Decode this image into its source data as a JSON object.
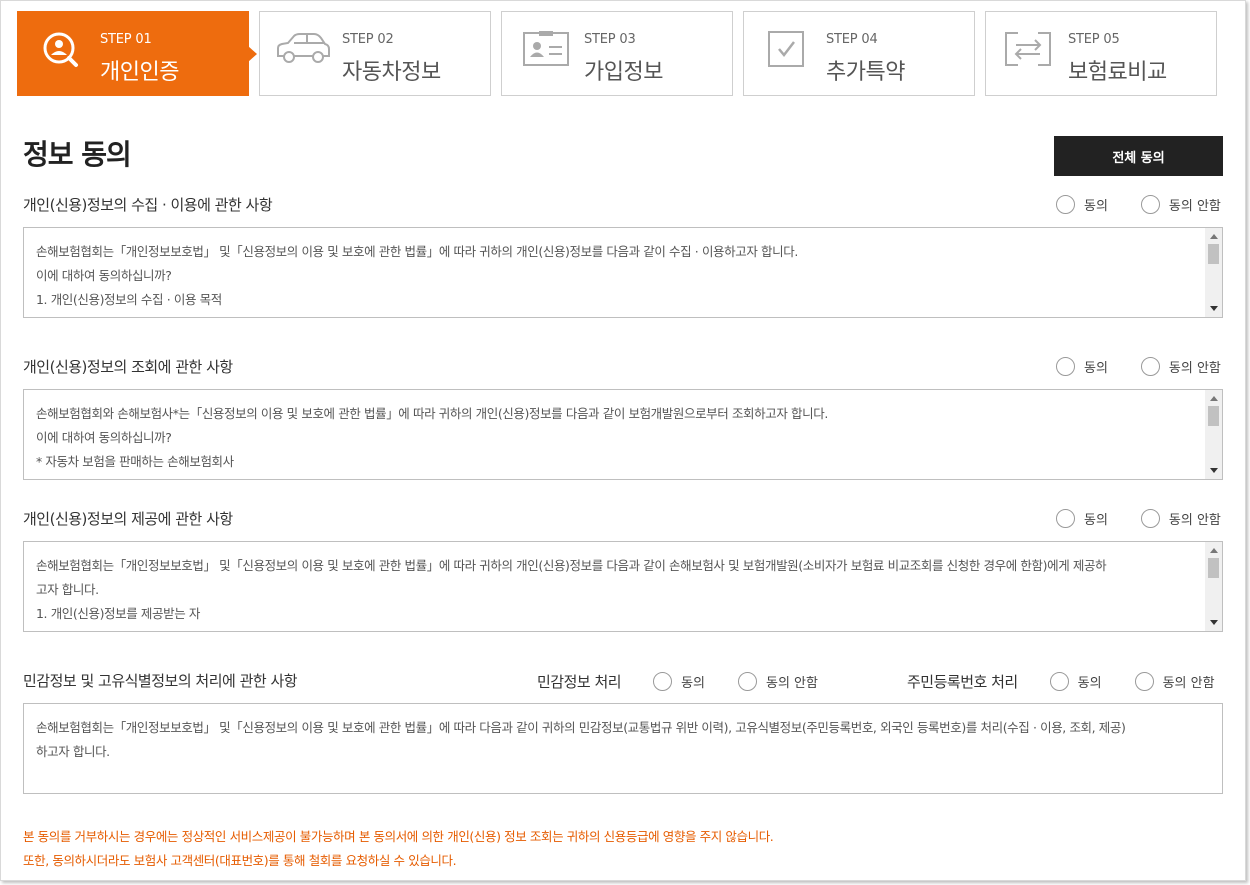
{
  "steps": [
    {
      "num": "STEP 01",
      "name": "개인인증",
      "icon": "search-person-icon",
      "active": true
    },
    {
      "num": "STEP 02",
      "name": "자동차정보",
      "icon": "car-icon",
      "active": false
    },
    {
      "num": "STEP 03",
      "name": "가입정보",
      "icon": "id-card-icon",
      "active": false
    },
    {
      "num": "STEP 04",
      "name": "추가특약",
      "icon": "checkbox-icon",
      "active": false
    },
    {
      "num": "STEP 05",
      "name": "보험료비교",
      "icon": "compare-arrows-icon",
      "active": false
    }
  ],
  "colors": {
    "accent": "#ee6c0e",
    "notice": "#e65c00",
    "dark_button": "#222222"
  },
  "page": {
    "title": "정보 동의",
    "agree_all_label": "전체 동의"
  },
  "radio": {
    "agree": "동의",
    "disagree": "동의 안함"
  },
  "sections": [
    {
      "title": "개인(신용)정보의 수집 · 이용에 관한 사항",
      "lines": [
        "손해보험협회는「개인정보보호법」 및「신용정보의 이용 및 보호에 관한 법률」에 따라 귀하의 개인(신용)정보를 다음과 같이 수집 · 이용하고자 합니다.",
        "이에 대하여 동의하십니까?",
        "1. 개인(신용)정보의 수집 · 이용 목적"
      ]
    },
    {
      "title": "개인(신용)정보의 조회에 관한 사항",
      "lines": [
        "손해보험협회와 손해보험사*는「신용정보의 이용 및 보호에 관한 법률」에 따라 귀하의 개인(신용)정보를 다음과 같이 보험개발원으로부터 조회하고자 합니다.",
        "이에 대하여 동의하십니까?",
        "* 자동차 보험을 판매하는 손해보험회사"
      ]
    },
    {
      "title": "개인(신용)정보의 제공에 관한 사항",
      "lines": [
        "손해보험협회는「개인정보보호법」 및「신용정보의 이용 및 보호에 관한 법률」에 따라 귀하의 개인(신용)정보를 다음과 같이 손해보험사 및 보험개발원(소비자가 보험료 비교조회를 신청한 경우에 한함)에게 제공하",
        "고자 합니다.",
        "1. 개인(신용)정보를 제공받는 자"
      ]
    },
    {
      "title": "민감정보 및 고유식별정보의 처리에 관한 사항",
      "sensitive_label": "민감정보 처리",
      "rrn_label": "주민등록번호 처리",
      "lines": [
        "손해보험협회는「개인정보보호법」 및「신용정보의 이용 및 보호에 관한 법률」에 따라 다음과 같이 귀하의 민감정보(교통법규 위반 이력), 고유식별정보(주민등록번호, 외국인 등록번호)를 처리(수집 · 이용, 조회, 제공)",
        "하고자 합니다."
      ]
    }
  ],
  "notice": [
    "본 동의를 거부하시는 경우에는 정상적인 서비스제공이 불가능하며 본 동의서에 의한 개인(신용) 정보 조회는 귀하의 신용등급에 영향을 주지 않습니다.",
    "또한, 동의하시더라도 보험사 고객센터(대표번호)를 통해 철회를 요청하실 수 있습니다."
  ]
}
